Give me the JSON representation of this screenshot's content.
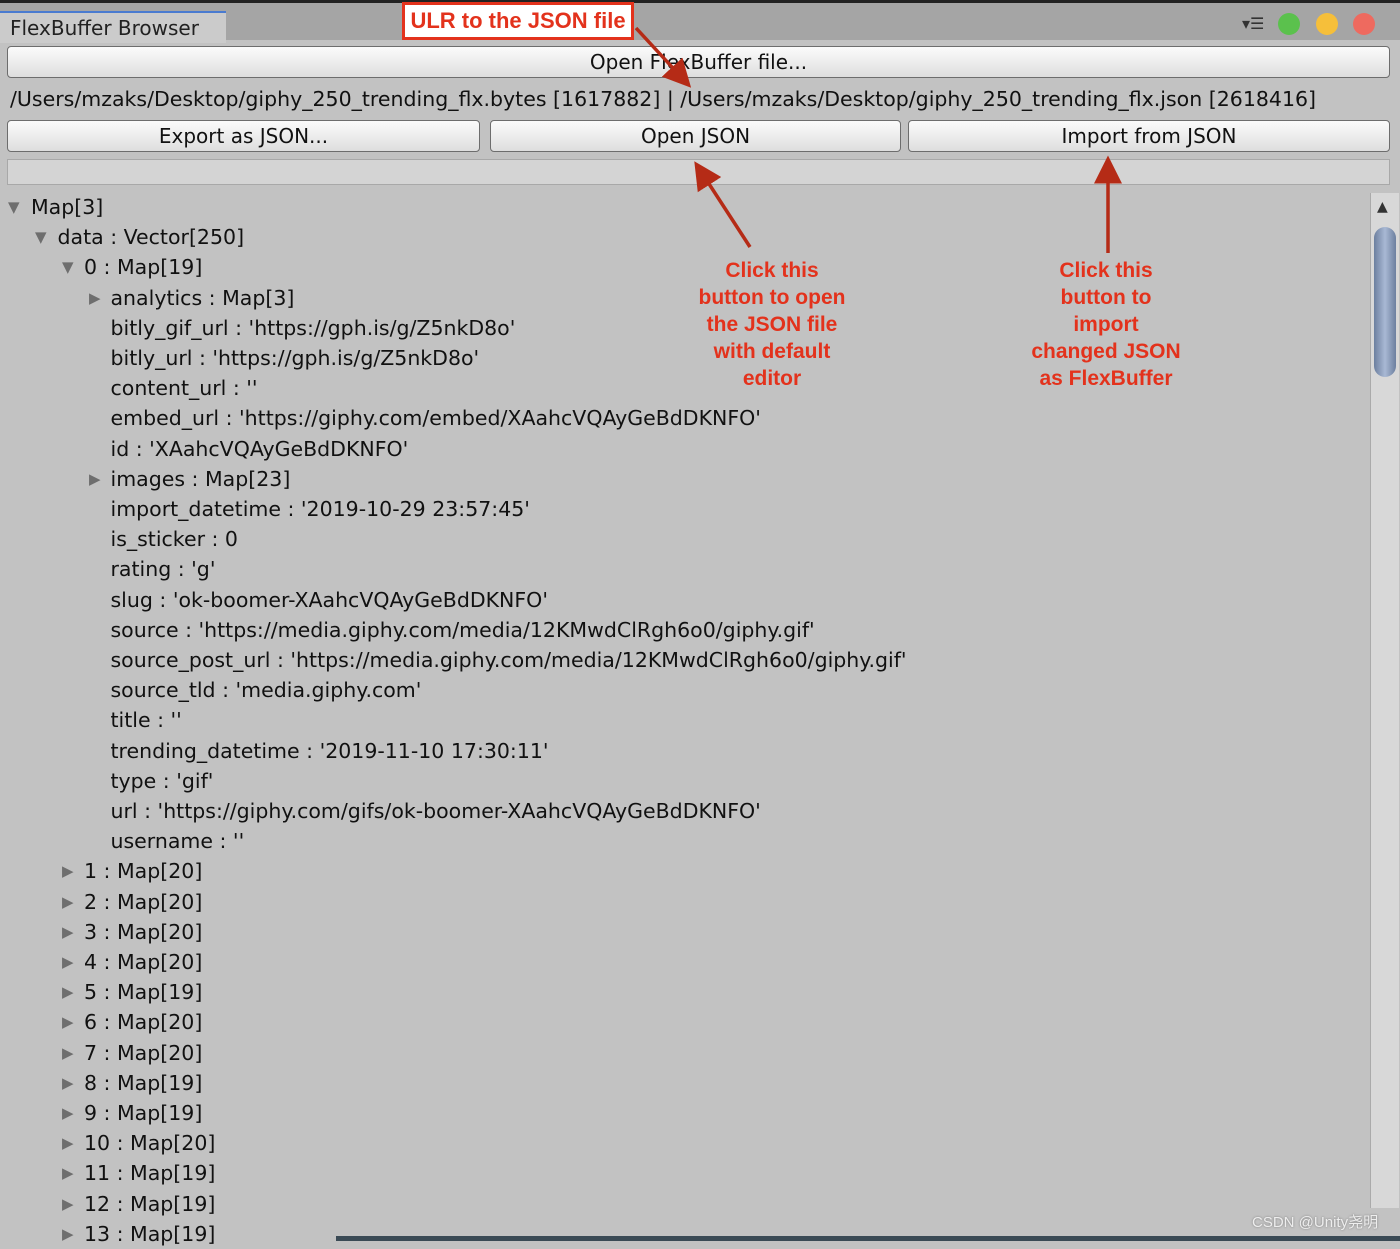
{
  "window": {
    "tab_title": "FlexBuffer Browser",
    "menu_icon": "menu-icon",
    "traffic_lights": {
      "green": "#5bc14d",
      "yellow": "#f6bf3a",
      "red": "#ee6a5f"
    }
  },
  "toolbar": {
    "open_flexbuffer_label": "Open FlexBuffer file...",
    "paths_text": "/Users/mzaks/Desktop/giphy_250_trending_flx.bytes [1617882] | /Users/mzaks/Desktop/giphy_250_trending_flx.json [2618416]",
    "export_label": "Export as JSON...",
    "open_json_label": "Open JSON",
    "import_label": "Import from JSON"
  },
  "tree": [
    {
      "level": 0,
      "state": "expanded",
      "text": "Map[3]"
    },
    {
      "level": 1,
      "state": "expanded",
      "text": "data : Vector[250]"
    },
    {
      "level": 2,
      "state": "expanded",
      "text": "0 : Map[19]"
    },
    {
      "level": 3,
      "state": "collapsed",
      "text": "analytics : Map[3]"
    },
    {
      "level": 3,
      "state": "leaf",
      "text": "bitly_gif_url : 'https://gph.is/g/Z5nkD8o'"
    },
    {
      "level": 3,
      "state": "leaf",
      "text": "bitly_url : 'https://gph.is/g/Z5nkD8o'"
    },
    {
      "level": 3,
      "state": "leaf",
      "text": "content_url : ''"
    },
    {
      "level": 3,
      "state": "leaf",
      "text": "embed_url : 'https://giphy.com/embed/XAahcVQAyGeBdDKNFO'"
    },
    {
      "level": 3,
      "state": "leaf",
      "text": "id : 'XAahcVQAyGeBdDKNFO'"
    },
    {
      "level": 3,
      "state": "collapsed",
      "text": "images : Map[23]"
    },
    {
      "level": 3,
      "state": "leaf",
      "text": "import_datetime : '2019-10-29 23:57:45'"
    },
    {
      "level": 3,
      "state": "leaf",
      "text": "is_sticker : 0"
    },
    {
      "level": 3,
      "state": "leaf",
      "text": "rating : 'g'"
    },
    {
      "level": 3,
      "state": "leaf",
      "text": "slug : 'ok-boomer-XAahcVQAyGeBdDKNFO'"
    },
    {
      "level": 3,
      "state": "leaf",
      "text": "source : 'https://media.giphy.com/media/12KMwdClRgh6o0/giphy.gif'"
    },
    {
      "level": 3,
      "state": "leaf",
      "text": "source_post_url : 'https://media.giphy.com/media/12KMwdClRgh6o0/giphy.gif'"
    },
    {
      "level": 3,
      "state": "leaf",
      "text": "source_tld : 'media.giphy.com'"
    },
    {
      "level": 3,
      "state": "leaf",
      "text": "title : ''"
    },
    {
      "level": 3,
      "state": "leaf",
      "text": "trending_datetime : '2019-11-10 17:30:11'"
    },
    {
      "level": 3,
      "state": "leaf",
      "text": "type : 'gif'"
    },
    {
      "level": 3,
      "state": "leaf",
      "text": "url : 'https://giphy.com/gifs/ok-boomer-XAahcVQAyGeBdDKNFO'"
    },
    {
      "level": 3,
      "state": "leaf",
      "text": "username : ''"
    },
    {
      "level": 2,
      "state": "collapsed",
      "text": "1 : Map[20]"
    },
    {
      "level": 2,
      "state": "collapsed",
      "text": "2 : Map[20]"
    },
    {
      "level": 2,
      "state": "collapsed",
      "text": "3 : Map[20]"
    },
    {
      "level": 2,
      "state": "collapsed",
      "text": "4 : Map[20]"
    },
    {
      "level": 2,
      "state": "collapsed",
      "text": "5 : Map[19]"
    },
    {
      "level": 2,
      "state": "collapsed",
      "text": "6 : Map[20]"
    },
    {
      "level": 2,
      "state": "collapsed",
      "text": "7 : Map[20]"
    },
    {
      "level": 2,
      "state": "collapsed",
      "text": "8 : Map[19]"
    },
    {
      "level": 2,
      "state": "collapsed",
      "text": "9 : Map[19]"
    },
    {
      "level": 2,
      "state": "collapsed",
      "text": "10 : Map[20]"
    },
    {
      "level": 2,
      "state": "collapsed",
      "text": "11 : Map[19]"
    },
    {
      "level": 2,
      "state": "collapsed",
      "text": "12 : Map[19]"
    },
    {
      "level": 2,
      "state": "collapsed",
      "text": "13 : Map[19]"
    }
  ],
  "annotations": {
    "color": "#e3321c",
    "url_label": "ULR to the JSON file",
    "open_json_note": [
      "Click this",
      "button to open",
      "the JSON file",
      "with default",
      "editor"
    ],
    "import_note": [
      "Click this",
      "button to",
      "import",
      "changed JSON",
      "as FlexBuffer"
    ]
  },
  "watermark": "CSDN @Unity尧明"
}
